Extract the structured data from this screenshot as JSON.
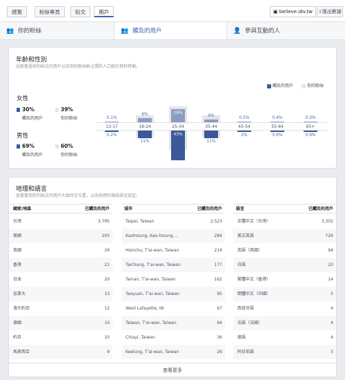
{
  "top_tabs": [
    {
      "label": "總覽"
    },
    {
      "label": "粉絲專頁"
    },
    {
      "label": "貼文"
    },
    {
      "label": "用戶"
    }
  ],
  "url_label": "believe.idv.tw",
  "export_label": "匯出數據",
  "segments": [
    {
      "label": "你的粉絲",
      "icon": "people-icon"
    },
    {
      "label": "觸及的用戶",
      "icon": "people-icon"
    },
    {
      "label": "參與互動的人",
      "icon": "person-add-icon"
    }
  ],
  "age_gender": {
    "title": "年齡和性別",
    "subtitle": "比較看過你的貼文的用戶以及你的粉絲群之間的人口統計資料特徵。",
    "legend_reached": "觸及的用戶",
    "legend_fans": "你的粉絲",
    "female": {
      "title": "女性",
      "reached_pct": "30%",
      "reached_label": "觸及的用戶",
      "fans_pct": "39%",
      "fans_label": "你的粉絲"
    },
    "male": {
      "title": "男性",
      "reached_pct": "69%",
      "reached_label": "觸及的用戶",
      "fans_pct": "60%",
      "fans_label": "你的粉絲"
    }
  },
  "chart_data": {
    "type": "bar",
    "categories": [
      "13-17",
      "18-24",
      "25-34",
      "35-44",
      "45-54",
      "55-64",
      "65+"
    ],
    "series": [
      {
        "name": "女性 觸及的用戶",
        "values": [
          0.1,
          6,
          19,
          4,
          0.5,
          0.4,
          0.3
        ]
      },
      {
        "name": "男性 觸及的用戶",
        "values": [
          0.2,
          11,
          43,
          11,
          2,
          0.6,
          0.9
        ]
      }
    ],
    "labels_top": [
      "0.1%",
      "6%",
      "19%",
      "4%",
      "0.5%",
      "0.4%",
      "0.3%"
    ],
    "labels_bottom": [
      "0.2%",
      "11%",
      "43%",
      "11%",
      "2%",
      "0.6%",
      "0.9%"
    ],
    "colors": {
      "female": "#8b9dc3",
      "male": "#3b5998",
      "fans_bg": "#e5e5e5"
    }
  },
  "geo": {
    "title": "地理和語言",
    "subtitle": "查看看到你的貼文的用戶大致所在位置，以及他們的預設語言設定。",
    "country_head": "國家/地區",
    "country_val_head": "已觸及的用戶",
    "city_head": "城市",
    "city_val_head": "已觸及的用戶",
    "lang_head": "語言",
    "lang_val_head": "已觸及的用戶",
    "countries": [
      [
        "台灣",
        "3,795"
      ],
      [
        "美國",
        "203"
      ],
      [
        "英國",
        "26"
      ],
      [
        "香港",
        "21"
      ],
      [
        "日本",
        "20"
      ],
      [
        "加拿大",
        "13"
      ],
      [
        "澳大利亞",
        "12"
      ],
      [
        "德國",
        "10"
      ],
      [
        "約旦",
        "10"
      ],
      [
        "馬來西亞",
        "9"
      ]
    ],
    "cities": [
      [
        "Taipei, Taiwan",
        "2,523"
      ],
      [
        "Kaohsiung, Kao-hsiung,...",
        "284"
      ],
      [
        "Hsinchu, T'ai-wan, Taiwan",
        "214"
      ],
      [
        "Taichung, T'ai-wan, Taiwan",
        "177"
      ],
      [
        "Tainan, T'ai-wan, Taiwan",
        "162"
      ],
      [
        "Taoyuan, T'ai-wan, Taiwan",
        "95"
      ],
      [
        "West Lafayette, IN",
        "67"
      ],
      [
        "Taiwan, T'ai-wan, Taiwan",
        "64"
      ],
      [
        "Chiayi, Taiwan",
        "36"
      ],
      [
        "Keelung, T'ai-wan, Taiwan",
        "26"
      ]
    ],
    "languages": [
      [
        "正體中文（台灣）",
        "3,302"
      ],
      [
        "美式英語",
        "726"
      ],
      [
        "英語（英國）",
        "94"
      ],
      [
        "日語",
        "20"
      ],
      [
        "繁體中文（香港）",
        "14"
      ],
      [
        "簡體中文（中國）",
        "5"
      ],
      [
        "西班牙語",
        "4"
      ],
      [
        "法語（法國）",
        "4"
      ],
      [
        "德語",
        "4"
      ],
      [
        "阿拉伯語",
        "3"
      ]
    ],
    "see_more": "查看更多"
  }
}
